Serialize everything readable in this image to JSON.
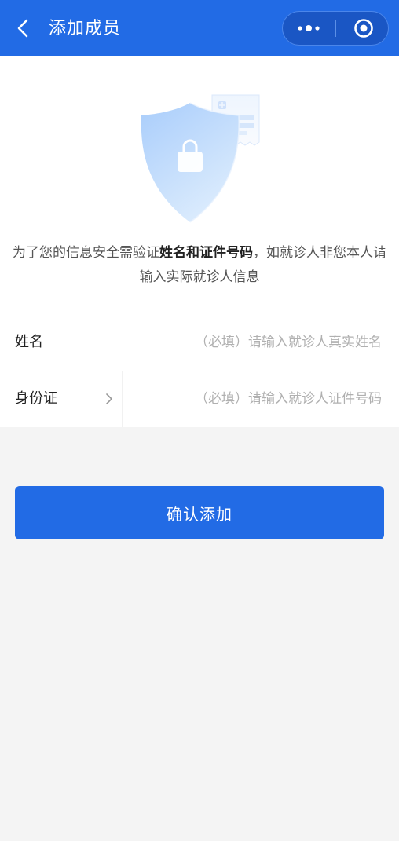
{
  "navbar": {
    "title": "添加成员",
    "back_icon": "chevron-left-icon",
    "more_icon": "more-dots-icon",
    "home_icon": "target-circle-icon",
    "background": "#226be5"
  },
  "illustration": {
    "icon": "shield-lock-icon"
  },
  "notice": {
    "prefix": "为了您的信息安全需验证",
    "highlight": "姓名和证件号码",
    "suffix": "，如就诊人非您本人请输入实际就诊人信息"
  },
  "form": {
    "name": {
      "label": "姓名",
      "value": "",
      "placeholder": "（必填）请输入就诊人真实姓名"
    },
    "id_card": {
      "label": "身份证",
      "value": "",
      "placeholder": "（必填）请输入就诊人证件号码",
      "chevron_icon": "chevron-right-icon"
    }
  },
  "confirm_button": {
    "label": "确认添加",
    "color": "#226be5"
  }
}
